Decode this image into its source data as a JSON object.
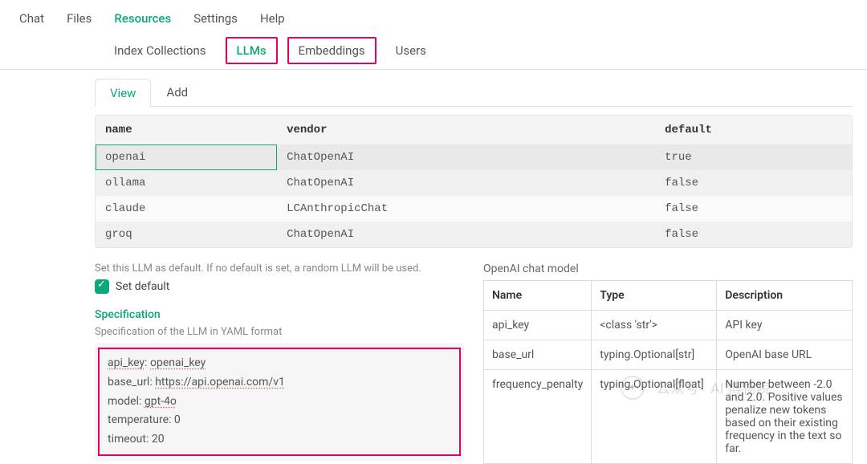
{
  "topnav": {
    "items": [
      "Chat",
      "Files",
      "Resources",
      "Settings",
      "Help"
    ],
    "active_index": 2
  },
  "subnav": {
    "items": [
      "Index Collections",
      "LLMs",
      "Embeddings",
      "Users"
    ],
    "active_index": 1,
    "highlight_indices": [
      1,
      2
    ]
  },
  "panel_tabs": {
    "items": [
      "View",
      "Add"
    ],
    "active_index": 0
  },
  "llm_table": {
    "columns": [
      "name",
      "vendor",
      "default"
    ],
    "rows": [
      {
        "name": "openai",
        "vendor": "ChatOpenAI",
        "default": "true",
        "selected": true
      },
      {
        "name": "ollama",
        "vendor": "ChatOpenAI",
        "default": "false"
      },
      {
        "name": "claude",
        "vendor": "LCAnthropicChat",
        "default": "false"
      },
      {
        "name": "groq",
        "vendor": "ChatOpenAI",
        "default": "false"
      }
    ]
  },
  "default_section": {
    "hint": "Set this LLM as default. If no default is set, a random LLM will be used.",
    "checkbox_label": "Set default",
    "checked": true
  },
  "spec_section": {
    "title": "Specification",
    "hint": "Specification of the LLM in YAML format",
    "yaml_lines": [
      {
        "key": "api_key",
        "value": "openai_key"
      },
      {
        "key": "base_url",
        "value": "https://api.openai.com/v1"
      },
      {
        "key": "model",
        "value": "gpt-4o"
      },
      {
        "key": "temperature",
        "value": "0"
      },
      {
        "key": "timeout",
        "value": "20"
      }
    ]
  },
  "openai_spec": {
    "title": "OpenAI chat model",
    "columns": [
      "Name",
      "Type",
      "Description"
    ],
    "rows": [
      {
        "name": "api_key",
        "type": "<class 'str'>",
        "desc": "API key"
      },
      {
        "name": "base_url",
        "type": "typing.Optional[str]",
        "desc": "OpenAI base URL"
      },
      {
        "name": "frequency_penalty",
        "type": "typing.Optional[float]",
        "desc": "Number between -2.0 and 2.0. Positive values penalize new tokens based on their existing frequency in the text so far."
      }
    ]
  },
  "watermark": {
    "label": "公众号",
    "sub": "AI  博物院"
  }
}
